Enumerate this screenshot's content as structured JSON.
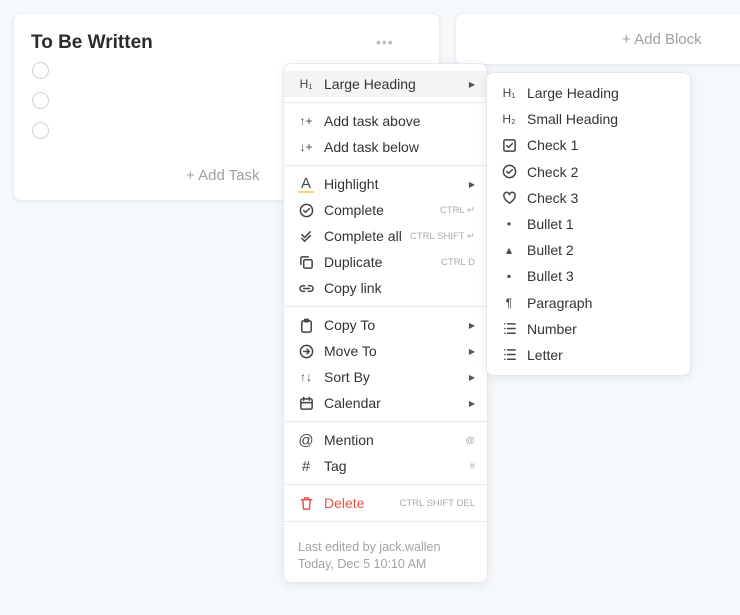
{
  "card": {
    "title": "To Be Written",
    "more": "•••",
    "add_task": "+  Add Task"
  },
  "block": {
    "add_block": "+ Add Block"
  },
  "menu": {
    "large_heading": "Large Heading",
    "add_above": "Add task above",
    "add_below": "Add task below",
    "highlight": "Highlight",
    "complete": "Complete",
    "complete_sc": "CTRL ↵",
    "complete_all": "Complete all",
    "complete_all_sc": "CTRL SHIFT ↵",
    "duplicate": "Duplicate",
    "duplicate_sc": "CTRL D",
    "copy_link": "Copy link",
    "copy_to": "Copy To",
    "move_to": "Move To",
    "sort_by": "Sort By",
    "calendar": "Calendar",
    "mention": "Mention",
    "mention_sc": "@",
    "tag": "Tag",
    "tag_sc": "#",
    "delete": "Delete",
    "delete_sc": "CTRL SHIFT DEL",
    "footer1": "Last edited by jack.wallen",
    "footer2": "Today, Dec 5 10:10 AM"
  },
  "submenu": {
    "items": [
      "Large Heading",
      "Small Heading",
      "Check 1",
      "Check 2",
      "Check 3",
      "Bullet 1",
      "Bullet 2",
      "Bullet 3",
      "Paragraph",
      "Number",
      "Letter"
    ],
    "glyphs": [
      "H₁",
      "H₂",
      "",
      "",
      "",
      "•",
      "▴",
      "▪",
      "¶",
      "",
      ""
    ]
  }
}
